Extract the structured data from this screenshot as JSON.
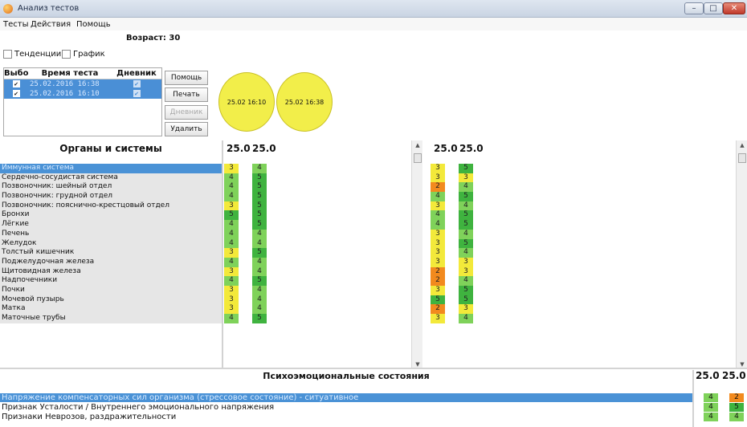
{
  "window": {
    "title": "Анализ тестов"
  },
  "menu": [
    "Тесты",
    "Действия",
    "Помощь"
  ],
  "age_label": "Возраст: 30",
  "options": [
    {
      "label": "Тенденции",
      "checked": false
    },
    {
      "label": "График",
      "checked": false
    }
  ],
  "tests_table": {
    "headers": [
      "Выбо",
      "Время теста",
      "Дневник"
    ],
    "rows": [
      {
        "time": "25.02.2016 16:38"
      },
      {
        "time": "25.02.2016 16:10"
      }
    ]
  },
  "buttons": [
    "Помощь",
    "Печать",
    "Дневник",
    "Удалить"
  ],
  "circles": [
    "25.02 16:10",
    "25.02 16:38"
  ],
  "organs": {
    "title": "Органы и системы",
    "col_headers": [
      "25.0",
      "25.0"
    ],
    "right_headers": [
      "25.0",
      "25.0"
    ],
    "rows": [
      {
        "name": "Иммунная система",
        "a": "3",
        "b": "4",
        "c": "3",
        "d": "5"
      },
      {
        "name": "Сердечно-сосудистая система",
        "a": "4",
        "b": "5",
        "c": "3",
        "d": "3"
      },
      {
        "name": "Позвоночник: шейный отдел",
        "a": "4",
        "b": "5",
        "c": "2",
        "d": "4"
      },
      {
        "name": "Позвоночник: грудной отдел",
        "a": "4",
        "b": "5",
        "c": "4",
        "d": "5"
      },
      {
        "name": "Позвоночник: пояснично-крестцовый отдел",
        "a": "3",
        "b": "5",
        "c": "3",
        "d": "4"
      },
      {
        "name": "Бронхи",
        "a": "5",
        "b": "5",
        "c": "4",
        "d": "5"
      },
      {
        "name": "Лёгкие",
        "a": "4",
        "b": "5",
        "c": "4",
        "d": "5"
      },
      {
        "name": "Печень",
        "a": "4",
        "b": "4",
        "c": "3",
        "d": "4"
      },
      {
        "name": "Желудок",
        "a": "4",
        "b": "4",
        "c": "3",
        "d": "5"
      },
      {
        "name": "Толстый кишечник",
        "a": "3",
        "b": "5",
        "c": "3",
        "d": "4"
      },
      {
        "name": "Поджелудочная железа",
        "a": "4",
        "b": "4",
        "c": "3",
        "d": "3"
      },
      {
        "name": "Щитовидная железа",
        "a": "3",
        "b": "4",
        "c": "2",
        "d": "3"
      },
      {
        "name": "Надпочечники",
        "a": "4",
        "b": "5",
        "c": "2",
        "d": "4"
      },
      {
        "name": "Почки",
        "a": "3",
        "b": "4",
        "c": "3",
        "d": "5"
      },
      {
        "name": "Мочевой пузырь",
        "a": "3",
        "b": "4",
        "c": "5",
        "d": "5"
      },
      {
        "name": "Матка",
        "a": "3",
        "b": "4",
        "c": "2",
        "d": "3"
      },
      {
        "name": "Маточные трубы",
        "a": "4",
        "b": "5",
        "c": "3",
        "d": "4"
      }
    ]
  },
  "psycho": {
    "title": "Психоэмоциональные состояния",
    "col_headers": [
      "25.0",
      "25.0"
    ],
    "rows": [
      {
        "name": "Напряжение компенсаторных сил организма (стрессовое состояние) - ситуативное",
        "a": "4",
        "b": "2"
      },
      {
        "name": "Признак Усталости / Внутреннего эмоционального напряжения",
        "a": "4",
        "b": "5"
      },
      {
        "name": "Признаки Неврозов, раздражительности",
        "a": "4",
        "b": "4"
      }
    ]
  },
  "score_colors": {
    "2": "#f28a1e",
    "3": "#f3e93a",
    "4": "#7fd25a",
    "5": "#3fb33f"
  }
}
